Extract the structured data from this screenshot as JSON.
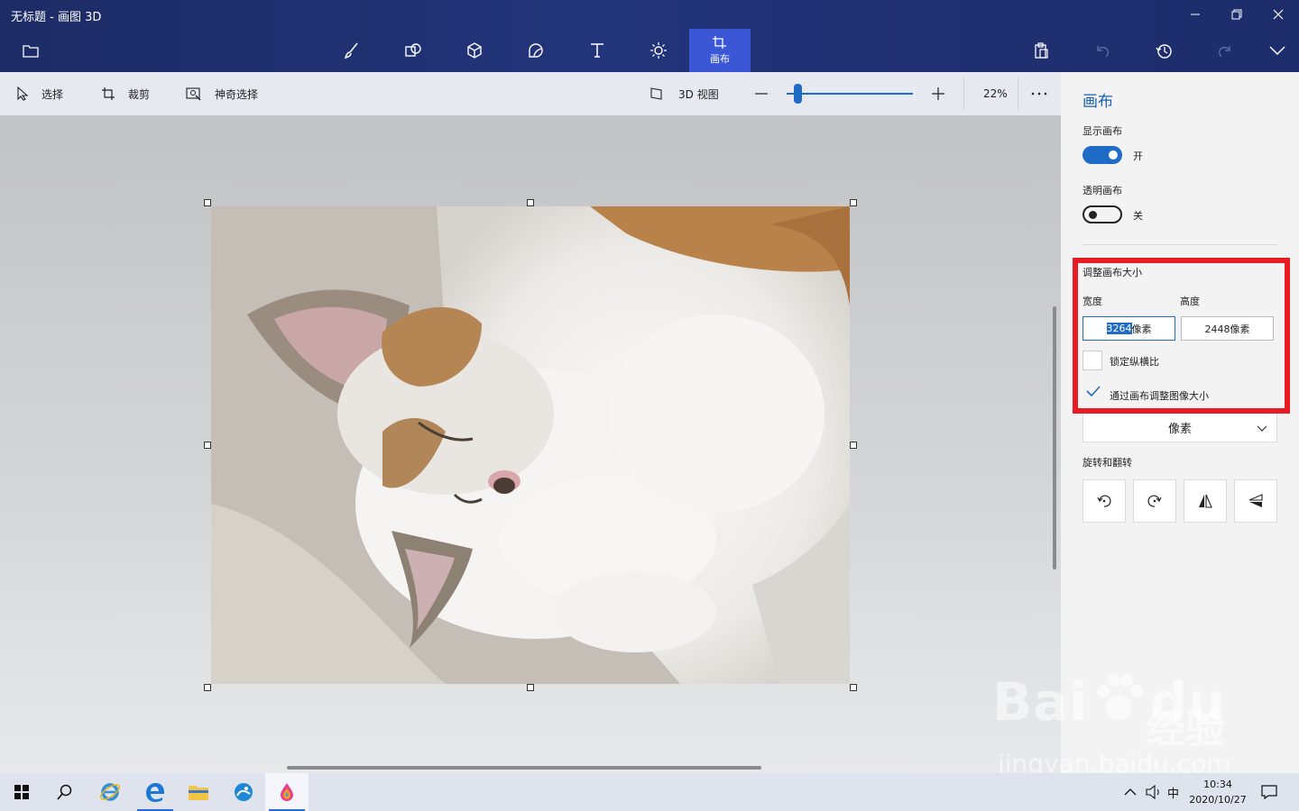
{
  "window": {
    "title": "无标题 - 画图 3D"
  },
  "ribbon": {
    "items": [
      {
        "name": "brushes",
        "icon": "brush-icon"
      },
      {
        "name": "2d-shapes",
        "icon": "2d-shapes-icon"
      },
      {
        "name": "3d-shapes",
        "icon": "3d-shapes-icon"
      },
      {
        "name": "stickers",
        "icon": "sticker-icon"
      },
      {
        "name": "text",
        "icon": "text-icon"
      },
      {
        "name": "effects",
        "icon": "sun-icon"
      },
      {
        "name": "canvas",
        "icon": "canvas-icon",
        "label": "画布",
        "active": true
      }
    ]
  },
  "toolbar": {
    "select_label": "选择",
    "crop_label": "裁剪",
    "magic_select_label": "神奇选择",
    "view3d_label": "3D 视图",
    "zoom_text": "22%",
    "zoom_percent": 22
  },
  "panel": {
    "title": "画布",
    "show_canvas_label": "显示画布",
    "show_canvas_state": "开",
    "show_canvas_on": true,
    "transparent_canvas_label": "透明画布",
    "transparent_canvas_state": "关",
    "transparent_canvas_on": false,
    "resize_heading": "调整画布大小",
    "width_label": "宽度",
    "height_label": "高度",
    "width_number": "3264",
    "width_unit": "像素",
    "height_value": "2448像素",
    "lock_aspect_label": "锁定纵横比",
    "lock_aspect_checked": false,
    "resize_image_label": "通过画布调整图像大小",
    "resize_image_checked": true,
    "unit_dropdown": "像素",
    "rotate_heading": "旋转和翻转"
  },
  "taskbar": {
    "ime": "中",
    "time": "10:34",
    "date": "2020/10/27"
  },
  "watermark": {
    "brand": "Bai",
    "brand2": "du",
    "jingyan": "经验",
    "url": "jingyan.baidu.com"
  },
  "colors": {
    "accent": "#1f6bc8",
    "highlight_box": "#e81c24",
    "titlebar": "#1f2f6e"
  }
}
